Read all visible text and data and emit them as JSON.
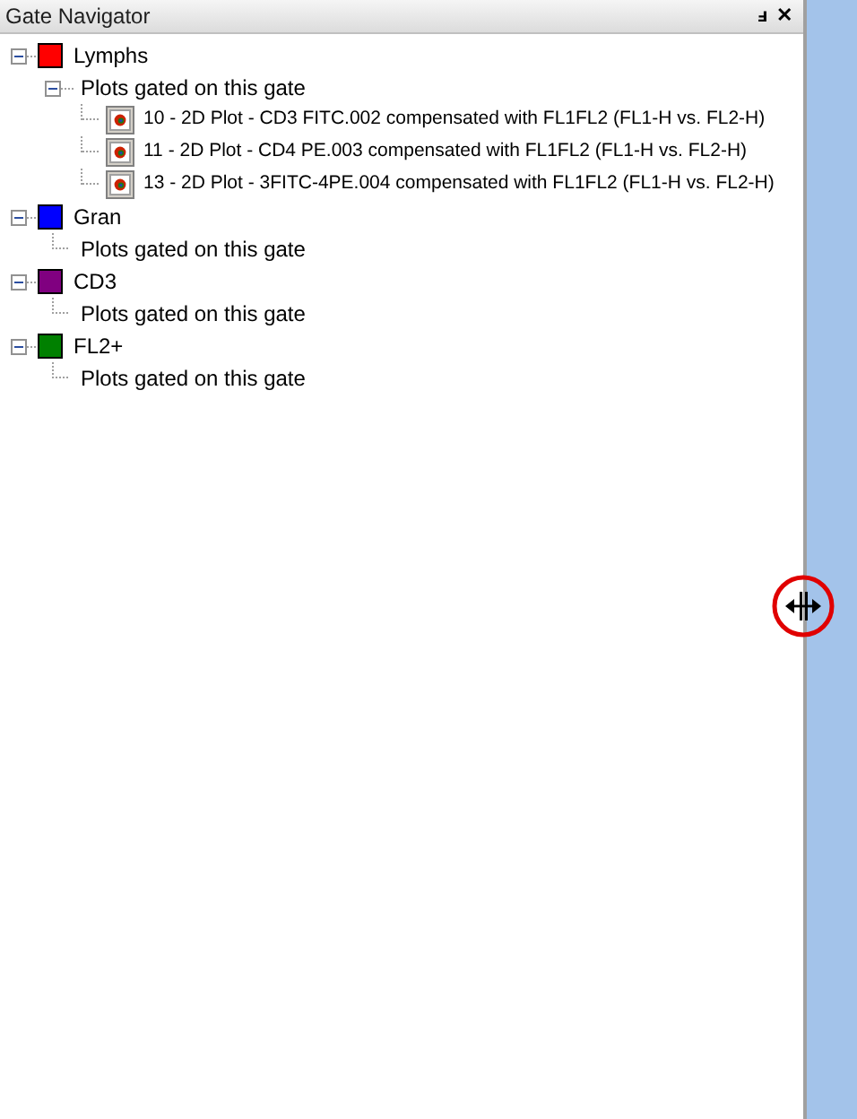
{
  "panel": {
    "title": "Gate Navigator",
    "pin_icon": "ⅎ",
    "close_icon": "✕"
  },
  "gates": [
    {
      "name": "Lymphs",
      "color": "#ff0000",
      "expanded": true,
      "children": [
        {
          "label": "Plots gated on this gate",
          "expanded": true,
          "children": [
            {
              "label": "10 - 2D Plot - CD3 FITC.002 compensated with FL1FL2 (FL1-H vs. FL2-H)"
            },
            {
              "label": "11 - 2D Plot - CD4 PE.003 compensated with FL1FL2 (FL1-H vs. FL2-H)"
            },
            {
              "label": "13 - 2D Plot - 3FITC-4PE.004 compensated with FL1FL2 (FL1-H vs. FL2-H)"
            }
          ]
        }
      ]
    },
    {
      "name": "Gran",
      "color": "#0000ff",
      "expanded": true,
      "children": [
        {
          "label": "Plots gated on this gate"
        }
      ]
    },
    {
      "name": "CD3",
      "color": "#800080",
      "expanded": true,
      "children": [
        {
          "label": "Plots gated on this gate"
        }
      ]
    },
    {
      "name": "FL2+",
      "color": "#008000",
      "expanded": true,
      "children": [
        {
          "label": "Plots gated on this gate"
        }
      ]
    }
  ]
}
